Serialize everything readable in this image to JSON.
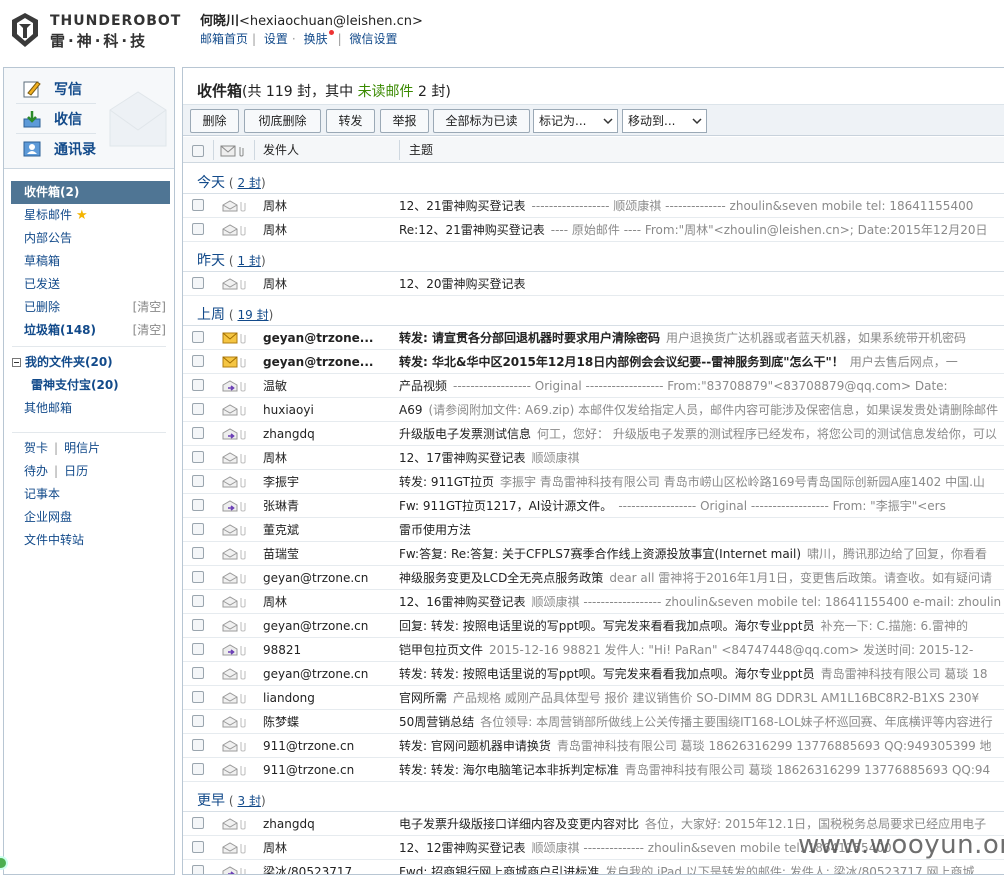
{
  "logo": {
    "en": "THUNDEROBOT",
    "cn": "雷·神·科·技"
  },
  "user": {
    "name": "何晓川",
    "email": "<hexiaochuan@leishen.cn>"
  },
  "header_links": [
    "邮箱首页",
    "设置",
    "换肤",
    "微信设置"
  ],
  "quick": {
    "compose": "写信",
    "receive": "收信",
    "contacts": "通讯录"
  },
  "folders": {
    "inbox": "收件箱(2)",
    "starred": "星标邮件",
    "announce": "内部公告",
    "drafts": "草稿箱",
    "sent": "已发送",
    "deleted": "已删除",
    "spam": "垃圾箱(148)",
    "clear": "[清空]",
    "my_folders": "我的文件夹(20)",
    "alipay": "雷神支付宝(20)",
    "other": "其他邮箱"
  },
  "tools": {
    "card": "贺卡",
    "postcard": "明信片",
    "todo": "待办",
    "calendar": "日历",
    "notes": "记事本",
    "disk": "企业网盘",
    "transfer": "文件中转站"
  },
  "main": {
    "title": "收件箱",
    "summary_a": "(共 119 封，其中 ",
    "unread_link": "未读邮件",
    "summary_b": " 2 封)"
  },
  "toolbar": {
    "delete": "删除",
    "purge": "彻底删除",
    "forward": "转发",
    "report": "举报",
    "mark_all_read": "全部标为已读",
    "mark_as": "标记为...",
    "move_to": "移动到..."
  },
  "columns": {
    "sender": "发件人",
    "subject": "主题"
  },
  "groups": [
    {
      "name": "今天",
      "count": "2 封",
      "rows": [
        {
          "from": "周林",
          "subject": "12、21雷神购买登记表",
          "preview": "------------------ 顺颂康祺 -------------- zhoulin&seven mobile tel: 18641155400",
          "icon": "read-envelope-icon",
          "unread": false
        },
        {
          "from": "周林",
          "subject": "Re:12、21雷神购买登记表",
          "preview": "---- 原始邮件 ---- From:\"周林\"<zhoulin@leishen.cn>; Date:2015年12月20日",
          "icon": "read-envelope-icon",
          "unread": false
        }
      ]
    },
    {
      "name": "昨天",
      "count": "1 封",
      "rows": [
        {
          "from": "周林",
          "subject": "12、20雷神购买登记表",
          "preview": "",
          "icon": "read-envelope-icon",
          "unread": false
        }
      ]
    },
    {
      "name": "上周",
      "count": "19 封",
      "rows": [
        {
          "from": "geyan@trzone...",
          "subject": "转发: 请宣贯各分部回退机器时要求用户清除密码",
          "preview": "用户退换货广达机器或者蓝天机器，如果系统带开机密码",
          "icon": "unread-envelope-icon",
          "unread": true
        },
        {
          "from": "geyan@trzone...",
          "subject": "转发: 华北&华中区2015年12月18日内部例会会议纪要--雷神服务到底\"怎么干\"！",
          "preview": "用户去售后网点，一",
          "icon": "unread-envelope-icon",
          "unread": true
        },
        {
          "from": "温敏",
          "subject": "产品视频",
          "preview": "------------------ Original ------------------ From:\"83708879\"<83708879@qq.com> Date:",
          "icon": "forwarded-envelope-icon",
          "unread": false
        },
        {
          "from": "huxiaoyi",
          "subject": "A69",
          "preview": "(请参阅附加文件: A69.zip) 本邮件仅发给指定人员，邮件内容可能涉及保密信息，如果误发贵处请删除邮件",
          "icon": "read-envelope-icon",
          "unread": false
        },
        {
          "from": "zhangdq",
          "subject": "升级版电子发票测试信息",
          "preview": "何工，您好： 升级版电子发票的测试程序已经发布，将您公司的测试信息发给你，可以",
          "icon": "forwarded-envelope-icon",
          "unread": false
        },
        {
          "from": "周林",
          "subject": "12、17雷神购买登记表",
          "preview": "顺颂康祺",
          "icon": "read-envelope-icon",
          "unread": false
        },
        {
          "from": "李振宇",
          "subject": "转发: 911GT拉页",
          "preview": "李振宇 青岛雷神科技有限公司 青岛市崂山区松岭路169号青岛国际创新园A座1402 中国.山",
          "icon": "read-envelope-icon",
          "unread": false
        },
        {
          "from": "张琳青",
          "subject": "Fw: 911GT拉页1217，AI设计源文件。",
          "preview": "------------------ Original ------------------ From: \"李振宇\"<ers",
          "icon": "forwarded-envelope-icon",
          "unread": false
        },
        {
          "from": "董克斌",
          "subject": "雷币使用方法",
          "preview": "",
          "icon": "read-envelope-icon",
          "unread": false
        },
        {
          "from": "苗瑞莹",
          "subject": "Fw:答复: Re:答复: 关于CFPLS7赛季合作线上资源投放事宜(Internet mail)",
          "preview": "啸川，腾讯那边给了回复，你看看",
          "icon": "read-envelope-icon",
          "unread": false
        },
        {
          "from": "geyan@trzone.cn",
          "subject": "神级服务变更及LCD全无亮点服务政策",
          "preview": "dear all 雷神将于2016年1月1日，变更售后政策。请查收。如有疑问请",
          "icon": "read-envelope-icon",
          "unread": false
        },
        {
          "from": "周林",
          "subject": "12、16雷神购买登记表",
          "preview": "顺颂康祺 ------------------ zhoulin&seven mobile tel: 18641155400 e-mail: zhoulin",
          "icon": "read-envelope-icon",
          "unread": false
        },
        {
          "from": "geyan@trzone.cn",
          "subject": "回复: 转发: 按照电话里说的写ppt呗。写完发来看看我加点呗。海尔专业ppt员",
          "preview": "补充一下: C.描施: 6.雷神的",
          "icon": "read-envelope-icon",
          "unread": false
        },
        {
          "from": "98821",
          "subject": "铠甲包拉页文件",
          "preview": "2015-12-16 98821 发件人: \"Hi! PaRan\" <84747448@qq.com> 发送时间: 2015-12-",
          "icon": "forwarded-envelope-icon",
          "unread": false
        },
        {
          "from": "geyan@trzone.cn",
          "subject": "转发: 转发: 按照电话里说的写ppt呗。写完发来看看我加点呗。海尔专业ppt员",
          "preview": "青岛雷神科技有限公司 葛琰 18",
          "icon": "read-envelope-icon",
          "unread": false
        },
        {
          "from": "liandong",
          "subject": "官网所需",
          "preview": "产品规格 威刚产品具体型号 报价 建议销售价 SO-DIMM 8G DDR3L AM1L16BC8R2-B1XS 230¥",
          "icon": "read-envelope-icon",
          "unread": false
        },
        {
          "from": "陈梦蝶",
          "subject": "50周营销总结",
          "preview": "各位领导: 本周营销部所做线上公关传播主要围绕IT168-LOL妹子杯巡回赛、年底横评等内容进行",
          "icon": "read-envelope-icon",
          "unread": false
        },
        {
          "from": "911@trzone.cn",
          "subject": "转发: 官网问题机器申请换货",
          "preview": "青岛雷神科技有限公司 葛琰 18626316299 13776885693 QQ:949305399 地",
          "icon": "read-envelope-icon",
          "unread": false
        },
        {
          "from": "911@trzone.cn",
          "subject": "转发: 转发: 海尔电脑笔记本非拆判定标准",
          "preview": "青岛雷神科技有限公司 葛琰 18626316299 13776885693 QQ:94",
          "icon": "read-envelope-icon",
          "unread": false
        }
      ]
    },
    {
      "name": "更早",
      "count": "3 封",
      "rows": [
        {
          "from": "zhangdq",
          "subject": "电子发票升级版接口详细内容及变更内容对比",
          "preview": "各位，大家好: 2015年12.1日，国税税务总局要求已经应用电子",
          "icon": "read-envelope-icon",
          "unread": false
        },
        {
          "from": "周林",
          "subject": "12、12雷神购买登记表",
          "preview": "顺颂康祺 -------------- zhoulin&seven mobile tel: 18641155400",
          "icon": "read-envelope-icon",
          "unread": false
        },
        {
          "from": "梁冰/80523717 ...",
          "subject": "Fwd: 招商银行网上商城商户引进标准",
          "preview": "发自我的 iPad 以下是转发的邮件: 发件人: 梁冰/80523717 网上商城",
          "icon": "forwarded-envelope-icon",
          "unread": false
        }
      ]
    }
  ],
  "watermark": "www.wooyun.org"
}
